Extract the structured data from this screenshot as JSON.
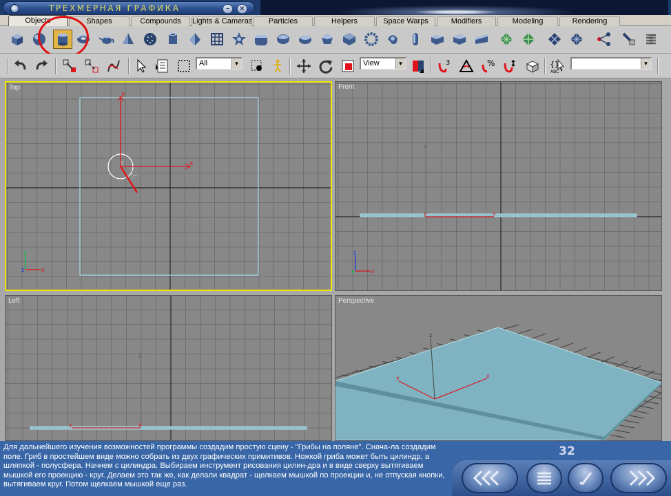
{
  "window": {
    "title": "ТРЕХМЕРНАЯ ГРАФИКА",
    "minimize_glyph": "–",
    "close_glyph": "×"
  },
  "tabs": [
    {
      "label": "Objects",
      "active": true
    },
    {
      "label": "Shapes"
    },
    {
      "label": "Compounds"
    },
    {
      "label": "Lights & Cameras"
    },
    {
      "label": "Particles"
    },
    {
      "label": "Helpers"
    },
    {
      "label": "Space Warps"
    },
    {
      "label": "Modifiers"
    },
    {
      "label": "Modeling"
    },
    {
      "label": "Rendering"
    }
  ],
  "toolbar_objects": {
    "icons": [
      "box-icon",
      "sphere-icon",
      "cylinder-icon",
      "torus-icon",
      "teapot-icon",
      "cone-icon",
      "geosphere-icon",
      "tube-icon",
      "pyramid-icon",
      "grid-plane-icon",
      "hedra-icon",
      "chamfer-box-icon",
      "oil-tank-icon",
      "spindle-icon",
      "gengon-icon",
      "ring-wave-icon",
      "torus-knot-icon",
      "capsule-icon",
      "l-ext-icon",
      "c-ext-icon",
      "prism-icon",
      "patch-grid-icon",
      "tri-patch-icon",
      "nurbs-surface-icon",
      "cv-surface-icon",
      "scatter-icon",
      "loft-icon",
      "spring-icon"
    ],
    "highlighted": "cylinder-icon"
  },
  "toolbar_main": {
    "selection_filter": "All",
    "reference_coord": "View",
    "named_selection": ""
  },
  "viewports": {
    "top": {
      "label": "Top"
    },
    "front": {
      "label": "Front"
    },
    "left": {
      "label": "Left"
    },
    "perspective": {
      "label": "Perspective"
    }
  },
  "axis_labels": {
    "x": "x",
    "y": "y",
    "z": "z"
  },
  "colors": {
    "viewport_bg": "#888888",
    "grid_line": "#6f6f6f",
    "active_border": "#f2e600",
    "plane_outline": "#a9dde8",
    "plane_fill": "#7fb3c2",
    "gizmo": "#e0141a",
    "bottom_panel": "#3866a7"
  },
  "description": "Для дальнейшего изучения возможностей программы создадим простую сцену - \"Грибы на поляне\". Снача-ла создадим поле. Гриб в простейшем виде можно собрать из двух графических примитивов. Ножкой гриба может быть цилиндр, а шляпкой - полусфера. Начнем с цилиндра. Выбираем инструмент рисования цилин-дра и в виде сверху вытягиваем мышкой его проекцию - круг. Делаем это так же, как делали квадрат - щелкаем мышкой по проекции и, не отпуская кнопки, вытягиваем круг. Потом щелкаем мышкой еще раз.",
  "page_number": "32",
  "nav_buttons": [
    {
      "name": "back-button",
      "icon": "double-chevron-left-icon"
    },
    {
      "name": "contents-button",
      "icon": "list-icon"
    },
    {
      "name": "check-button",
      "icon": "slash-icon"
    },
    {
      "name": "forward-button",
      "icon": "double-chevron-right-icon"
    }
  ]
}
